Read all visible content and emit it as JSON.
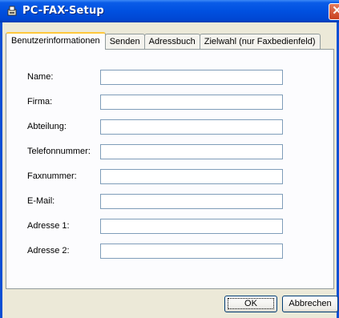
{
  "window": {
    "title": "PC-FAX-Setup",
    "close_symbol": "✕",
    "icons": {
      "app": "fax-app-icon",
      "close": "close-icon"
    }
  },
  "tabs": [
    {
      "label": "Benutzerinformationen",
      "active": true
    },
    {
      "label": "Senden",
      "active": false
    },
    {
      "label": "Adressbuch",
      "active": false
    },
    {
      "label": "Zielwahl (nur Faxbedienfeld)",
      "active": false
    }
  ],
  "fields": [
    {
      "label": "Name:",
      "value": ""
    },
    {
      "label": "Firma:",
      "value": ""
    },
    {
      "label": "Abteilung:",
      "value": ""
    },
    {
      "label": "Telefonnummer:",
      "value": ""
    },
    {
      "label": "Faxnummer:",
      "value": ""
    },
    {
      "label": "E-Mail:",
      "value": ""
    },
    {
      "label": "Adresse 1:",
      "value": ""
    },
    {
      "label": "Adresse 2:",
      "value": ""
    }
  ],
  "buttons": {
    "ok": "OK",
    "cancel": "Abbrechen"
  },
  "colors": {
    "titlebar": "#0050e0",
    "active_tab_accent": "#ffc83c",
    "close_button": "#c9401f"
  }
}
